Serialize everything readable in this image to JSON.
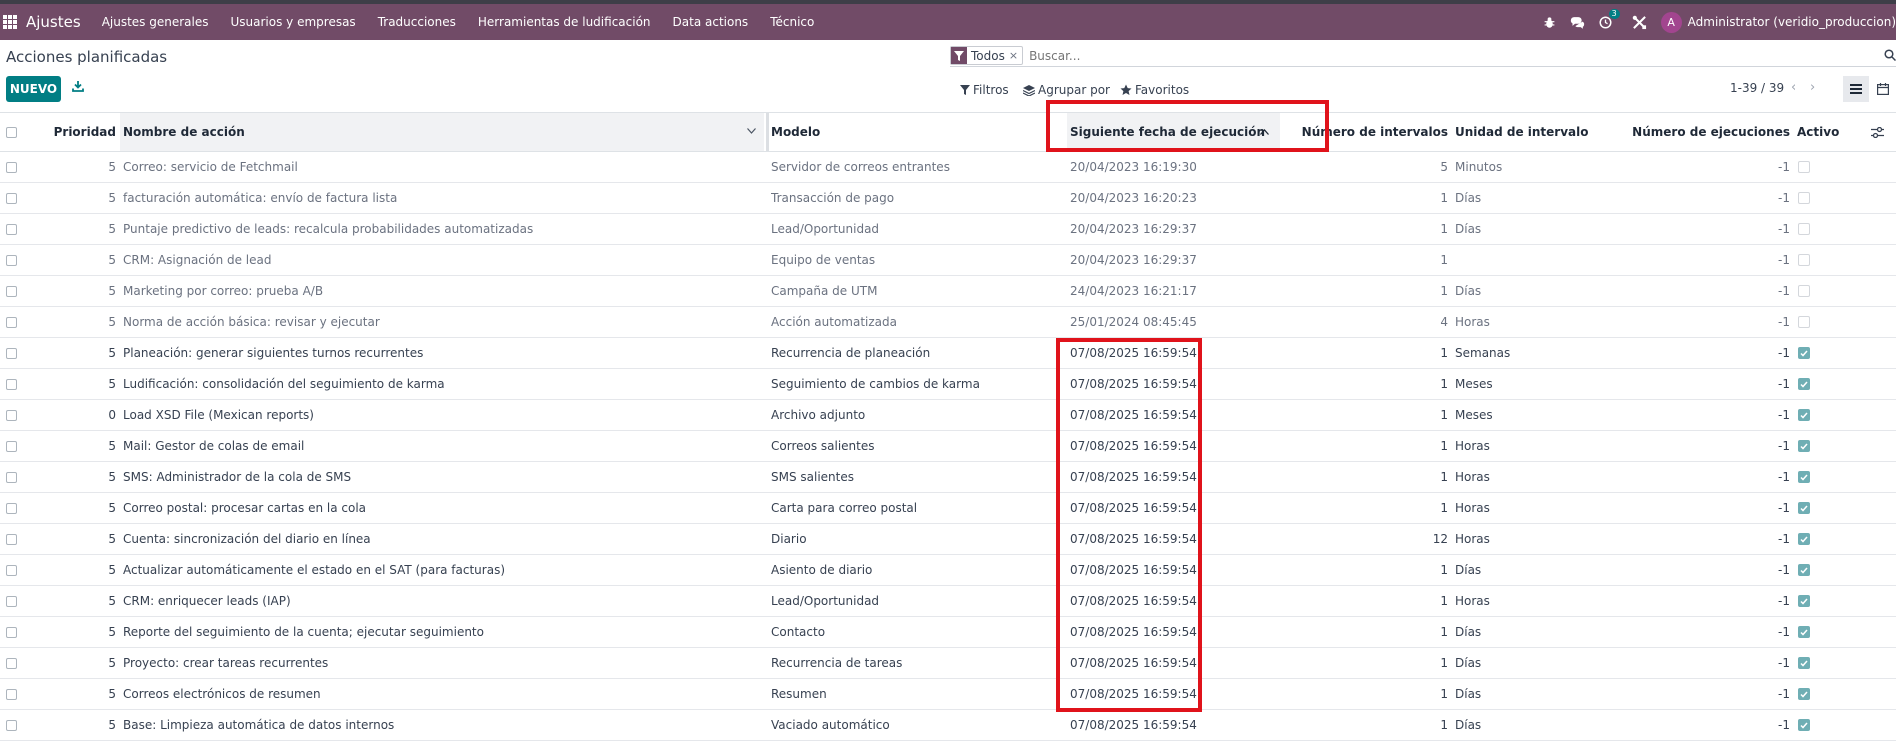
{
  "navbar": {
    "brand": "Ajustes",
    "menus": [
      "Ajustes generales",
      "Usuarios y empresas",
      "Traducciones",
      "Herramientas de ludificación",
      "Data actions",
      "Técnico"
    ],
    "activity_badge": "3",
    "avatar_letter": "A",
    "user_name": "Administrator (veridio_produccion)"
  },
  "page": {
    "title": "Acciones planificadas",
    "new_label": "NUEVO"
  },
  "search": {
    "facet_value": "Todos",
    "facet_remove": "×",
    "placeholder": "Buscar..."
  },
  "toolbar": {
    "filters": "Filtros",
    "group_by": "Agrupar por",
    "favorites": "Favoritos",
    "pager": "1-39 / 39"
  },
  "columns": {
    "priority": "Prioridad",
    "name": "Nombre de acción",
    "model": "Modelo",
    "nextcall": "Siguiente fecha de ejecución",
    "interval_number": "Número de intervalos",
    "interval_type": "Unidad de intervalo",
    "numbercall": "Número de ejecuciones",
    "active": "Activo"
  },
  "rows": [
    {
      "priority": "5",
      "name": "Correo: servicio de Fetchmail",
      "model": "Servidor de correos entrantes",
      "nextcall": "20/04/2023 16:19:30",
      "interval_number": "5",
      "interval_type": "Minutos",
      "numbercall": "-1",
      "active": false
    },
    {
      "priority": "5",
      "name": "facturación automática: envío de factura lista",
      "model": "Transacción de pago",
      "nextcall": "20/04/2023 16:20:23",
      "interval_number": "1",
      "interval_type": "Días",
      "numbercall": "-1",
      "active": false
    },
    {
      "priority": "5",
      "name": "Puntaje predictivo de leads: recalcula probabilidades automatizadas",
      "model": "Lead/Oportunidad",
      "nextcall": "20/04/2023 16:29:37",
      "interval_number": "1",
      "interval_type": "Días",
      "numbercall": "-1",
      "active": false
    },
    {
      "priority": "5",
      "name": "CRM: Asignación de lead",
      "model": "Equipo de ventas",
      "nextcall": "20/04/2023 16:29:37",
      "interval_number": "1",
      "interval_type": "",
      "numbercall": "-1",
      "active": false
    },
    {
      "priority": "5",
      "name": "Marketing por correo: prueba A/B",
      "model": "Campaña de UTM",
      "nextcall": "24/04/2023 16:21:17",
      "interval_number": "1",
      "interval_type": "Días",
      "numbercall": "-1",
      "active": false
    },
    {
      "priority": "5",
      "name": "Norma de acción básica: revisar y ejecutar",
      "model": "Acción automatizada",
      "nextcall": "25/01/2024 08:45:45",
      "interval_number": "4",
      "interval_type": "Horas",
      "numbercall": "-1",
      "active": false
    },
    {
      "priority": "5",
      "name": "Planeación: generar siguientes turnos recurrentes",
      "model": "Recurrencia de planeación",
      "nextcall": "07/08/2025 16:59:54",
      "interval_number": "1",
      "interval_type": "Semanas",
      "numbercall": "-1",
      "active": true
    },
    {
      "priority": "5",
      "name": "Ludificación: consolidación del seguimiento de karma",
      "model": "Seguimiento de cambios de karma",
      "nextcall": "07/08/2025 16:59:54",
      "interval_number": "1",
      "interval_type": "Meses",
      "numbercall": "-1",
      "active": true
    },
    {
      "priority": "0",
      "name": "Load XSD File (Mexican reports)",
      "model": "Archivo adjunto",
      "nextcall": "07/08/2025 16:59:54",
      "interval_number": "1",
      "interval_type": "Meses",
      "numbercall": "-1",
      "active": true
    },
    {
      "priority": "5",
      "name": "Mail: Gestor de colas de email",
      "model": "Correos salientes",
      "nextcall": "07/08/2025 16:59:54",
      "interval_number": "1",
      "interval_type": "Horas",
      "numbercall": "-1",
      "active": true
    },
    {
      "priority": "5",
      "name": "SMS: Administrador de la cola de SMS",
      "model": "SMS salientes",
      "nextcall": "07/08/2025 16:59:54",
      "interval_number": "1",
      "interval_type": "Horas",
      "numbercall": "-1",
      "active": true
    },
    {
      "priority": "5",
      "name": "Correo postal: procesar cartas en la cola",
      "model": "Carta para correo postal",
      "nextcall": "07/08/2025 16:59:54",
      "interval_number": "1",
      "interval_type": "Horas",
      "numbercall": "-1",
      "active": true
    },
    {
      "priority": "5",
      "name": "Cuenta: sincronización del diario en línea",
      "model": "Diario",
      "nextcall": "07/08/2025 16:59:54",
      "interval_number": "12",
      "interval_type": "Horas",
      "numbercall": "-1",
      "active": true
    },
    {
      "priority": "5",
      "name": "Actualizar automáticamente el estado en el SAT (para facturas)",
      "model": "Asiento de diario",
      "nextcall": "07/08/2025 16:59:54",
      "interval_number": "1",
      "interval_type": "Días",
      "numbercall": "-1",
      "active": true
    },
    {
      "priority": "5",
      "name": "CRM: enriquecer leads (IAP)",
      "model": "Lead/Oportunidad",
      "nextcall": "07/08/2025 16:59:54",
      "interval_number": "1",
      "interval_type": "Horas",
      "numbercall": "-1",
      "active": true
    },
    {
      "priority": "5",
      "name": "Reporte del seguimiento de la cuenta; ejecutar seguimiento",
      "model": "Contacto",
      "nextcall": "07/08/2025 16:59:54",
      "interval_number": "1",
      "interval_type": "Días",
      "numbercall": "-1",
      "active": true
    },
    {
      "priority": "5",
      "name": "Proyecto: crear tareas recurrentes",
      "model": "Recurrencia de tareas",
      "nextcall": "07/08/2025 16:59:54",
      "interval_number": "1",
      "interval_type": "Días",
      "numbercall": "-1",
      "active": true
    },
    {
      "priority": "5",
      "name": "Correos electrónicos de resumen",
      "model": "Resumen",
      "nextcall": "07/08/2025 16:59:54",
      "interval_number": "1",
      "interval_type": "Días",
      "numbercall": "-1",
      "active": true
    },
    {
      "priority": "5",
      "name": "Base: Limpieza automática de datos internos",
      "model": "Vaciado automático",
      "nextcall": "07/08/2025 16:59:54",
      "interval_number": "1",
      "interval_type": "Días",
      "numbercall": "-1",
      "active": true
    }
  ],
  "colors": {
    "navbar": "#714b67",
    "primary": "#017e84",
    "highlight": "#e0131b",
    "checked": "#6faeb4"
  }
}
